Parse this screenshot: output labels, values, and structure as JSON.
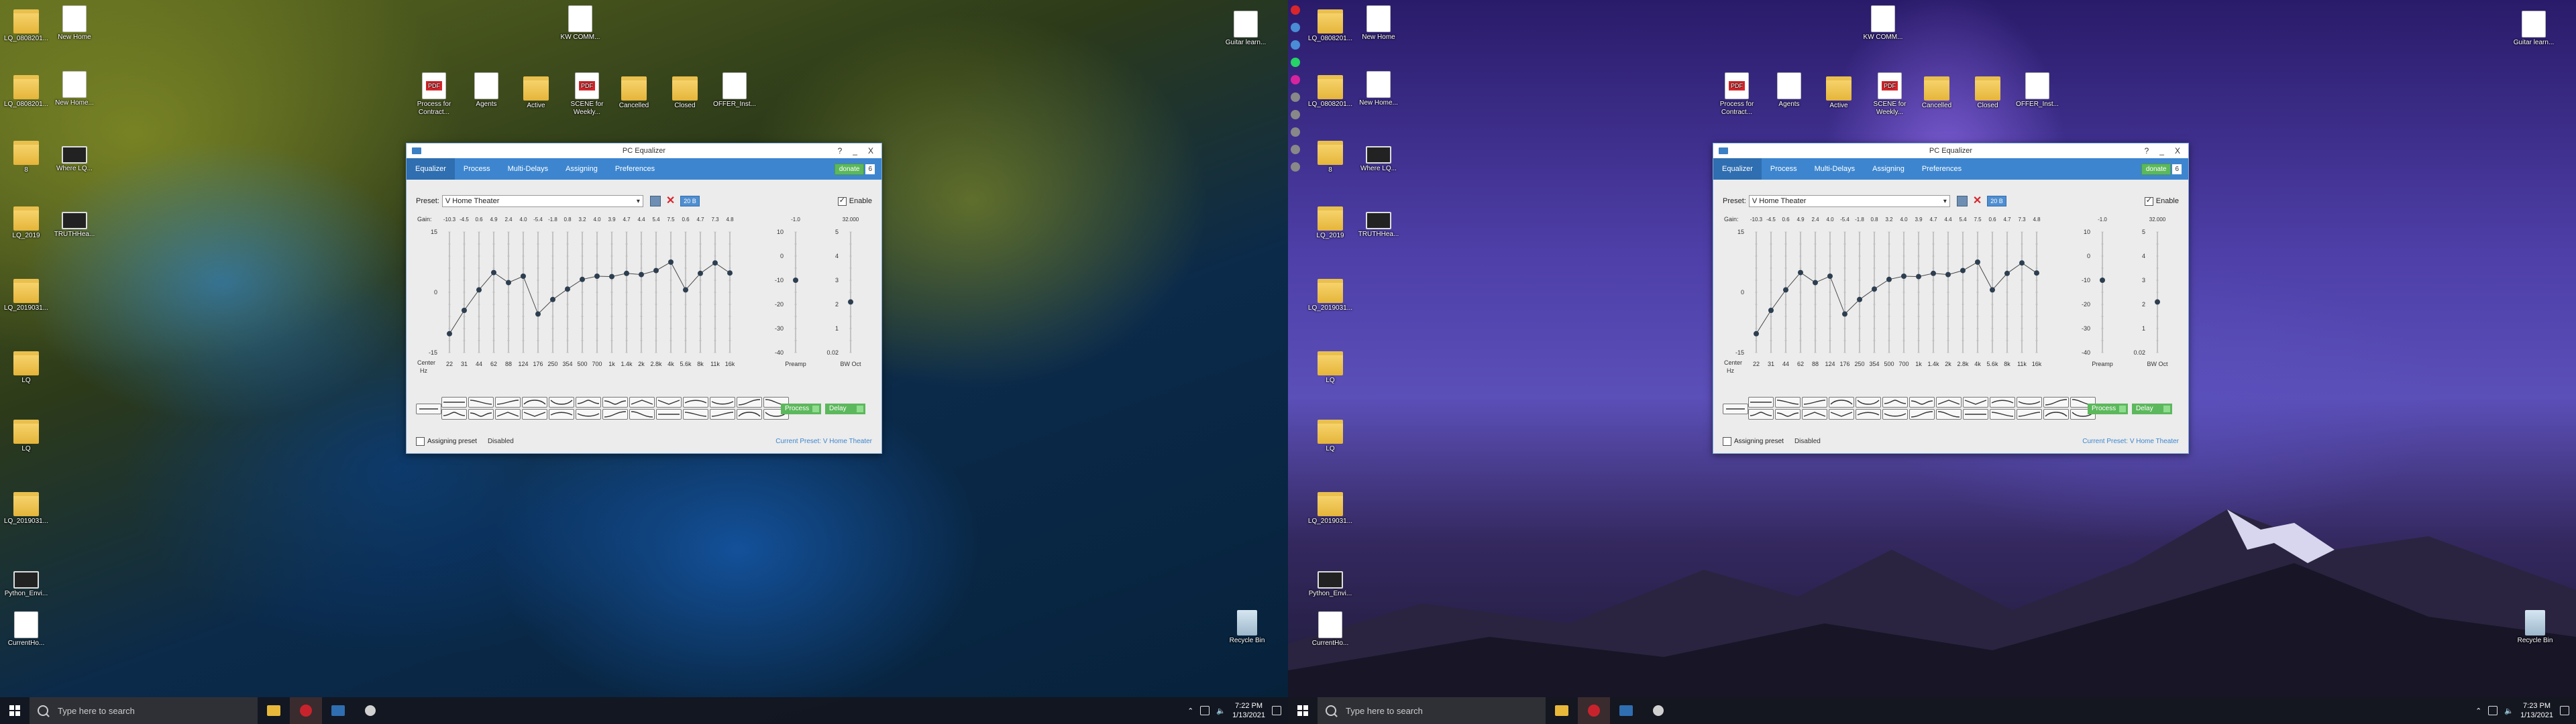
{
  "left_monitor": {
    "desktop_icons": [
      {
        "label": "LQ_0808201...",
        "kind": "folder"
      },
      {
        "label": "New Home",
        "kind": "doc"
      },
      {
        "label": "LQ_0808201...",
        "kind": "folder"
      },
      {
        "label": "New Home...",
        "kind": "doc"
      },
      {
        "label": "8",
        "kind": "folder"
      },
      {
        "label": "Where LQ...",
        "kind": "exe"
      },
      {
        "label": "LQ_2019",
        "kind": "folder"
      },
      {
        "label": "TRUTHHea...",
        "kind": "exe"
      },
      {
        "label": "LQ_2019031...",
        "kind": "folder"
      },
      {
        "label": "LQ",
        "kind": "folder"
      },
      {
        "label": "LQ",
        "kind": "folder"
      },
      {
        "label": "LQ_2019031...",
        "kind": "folder"
      },
      {
        "label": "Python_Envi...",
        "kind": "exe"
      },
      {
        "label": "CurrentHo...",
        "kind": "doc"
      }
    ],
    "top_icons": [
      {
        "label": "KW COMM...",
        "kind": "doc"
      },
      {
        "label": "Process for Contract...",
        "kind": "pdf"
      },
      {
        "label": "Agents",
        "kind": "doc"
      },
      {
        "label": "Active",
        "kind": "folder"
      },
      {
        "label": "SCENE for Weekly...",
        "kind": "pdf"
      },
      {
        "label": "Cancelled",
        "kind": "folder"
      },
      {
        "label": "Closed",
        "kind": "folder"
      },
      {
        "label": "OFFER_Inst...",
        "kind": "doc"
      }
    ],
    "right_icons": [
      {
        "label": "Guitar learn...",
        "kind": "doc"
      },
      {
        "label": "Recycle Bin",
        "kind": "recycle"
      }
    ]
  },
  "right_monitor": {
    "desktop_icons": [
      {
        "label": "LQ_0808201...",
        "kind": "folder"
      },
      {
        "label": "New Home",
        "kind": "doc"
      },
      {
        "label": "LQ_0808201...",
        "kind": "folder"
      },
      {
        "label": "New Home...",
        "kind": "doc"
      },
      {
        "label": "8",
        "kind": "folder"
      },
      {
        "label": "Where LQ...",
        "kind": "exe"
      },
      {
        "label": "LQ_2019",
        "kind": "folder"
      },
      {
        "label": "TRUTHHea...",
        "kind": "exe"
      },
      {
        "label": "LQ_2019031...",
        "kind": "folder"
      },
      {
        "label": "LQ",
        "kind": "folder"
      },
      {
        "label": "LQ",
        "kind": "folder"
      },
      {
        "label": "LQ_2019031...",
        "kind": "folder"
      },
      {
        "label": "Python_Envi...",
        "kind": "exe"
      },
      {
        "label": "CurrentHo...",
        "kind": "doc"
      }
    ],
    "top_icons": [
      {
        "label": "KW COMM...",
        "kind": "doc"
      },
      {
        "label": "Process for Contract...",
        "kind": "pdf"
      },
      {
        "label": "Agents",
        "kind": "doc"
      },
      {
        "label": "Active",
        "kind": "folder"
      },
      {
        "label": "SCENE for Weekly...",
        "kind": "pdf"
      },
      {
        "label": "Cancelled",
        "kind": "folder"
      },
      {
        "label": "Closed",
        "kind": "folder"
      },
      {
        "label": "OFFER_Inst...",
        "kind": "doc"
      }
    ],
    "right_icons": [
      {
        "label": "Guitar learn...",
        "kind": "doc"
      },
      {
        "label": "Recycle Bin",
        "kind": "recycle"
      }
    ]
  },
  "taskbar_left": {
    "search_placeholder": "Type here to search",
    "time": "7:22 PM",
    "date": "1/13/2021"
  },
  "taskbar_right": {
    "search_placeholder": "Type here to search",
    "time": "7:23 PM",
    "date": "1/13/2021"
  },
  "equalizer": {
    "title": "PC Equalizer",
    "title_buttons": [
      "?",
      "_",
      "X"
    ],
    "tabs": [
      "Equalizer",
      "Process",
      "Multi-Delays",
      "Assigning",
      "Preferences"
    ],
    "active_tab": 0,
    "donate_label": "donate",
    "donate_count": "6",
    "preset_label": "Preset:",
    "preset_value": "V Home Theater",
    "db_button": "20 B",
    "enable_label": "Enable",
    "gain_label": "Gain:",
    "center_label": "Center",
    "hz_label": "Hz",
    "preamp_label": "Preamp",
    "bw_label": "BW Oct",
    "assigning_label": "Assigning preset",
    "disabled_label": "Disabled",
    "current_preset": "Current Preset: V Home Theater",
    "process_btn": "Process",
    "delay_btn": "Delay",
    "y_ticks": [
      "15",
      "0",
      "-15"
    ],
    "preamp_ticks": [
      "10",
      "0",
      "-10",
      "-20",
      "-30",
      "-40"
    ],
    "bw_ticks": [
      "5",
      "4",
      "3",
      "2",
      "1",
      "0.02"
    ],
    "preamp_top_value": "-1.0",
    "bw_top_value": "32.000",
    "bands": [
      {
        "center": "22",
        "gain": "-10.3",
        "value": -10.3
      },
      {
        "center": "31",
        "gain": "-4.5",
        "value": -4.5
      },
      {
        "center": "44",
        "gain": "0.6",
        "value": 0.6
      },
      {
        "center": "62",
        "gain": "4.9",
        "value": 4.9
      },
      {
        "center": "88",
        "gain": "2.4",
        "value": 2.4
      },
      {
        "center": "124",
        "gain": "4.0",
        "value": 4.0
      },
      {
        "center": "176",
        "gain": "-5.4",
        "value": -5.4
      },
      {
        "center": "250",
        "gain": "-1.8",
        "value": -1.8
      },
      {
        "center": "354",
        "gain": "0.8",
        "value": 0.8
      },
      {
        "center": "500",
        "gain": "3.2",
        "value": 3.2
      },
      {
        "center": "700",
        "gain": "4.0",
        "value": 4.0
      },
      {
        "center": "1k",
        "gain": "3.9",
        "value": 3.9
      },
      {
        "center": "1.4k",
        "gain": "4.7",
        "value": 4.7
      },
      {
        "center": "2k",
        "gain": "4.4",
        "value": 4.4
      },
      {
        "center": "2.8k",
        "gain": "5.4",
        "value": 5.4
      },
      {
        "center": "4k",
        "gain": "7.5",
        "value": 7.5
      },
      {
        "center": "5.6k",
        "gain": "0.6",
        "value": 0.6
      },
      {
        "center": "8k",
        "gain": "4.7",
        "value": 4.7
      },
      {
        "center": "11k",
        "gain": "7.3",
        "value": 7.3
      },
      {
        "center": "16k",
        "gain": "4.8",
        "value": 4.8
      }
    ],
    "preamp_value": -10,
    "bw_value": 2.1
  }
}
